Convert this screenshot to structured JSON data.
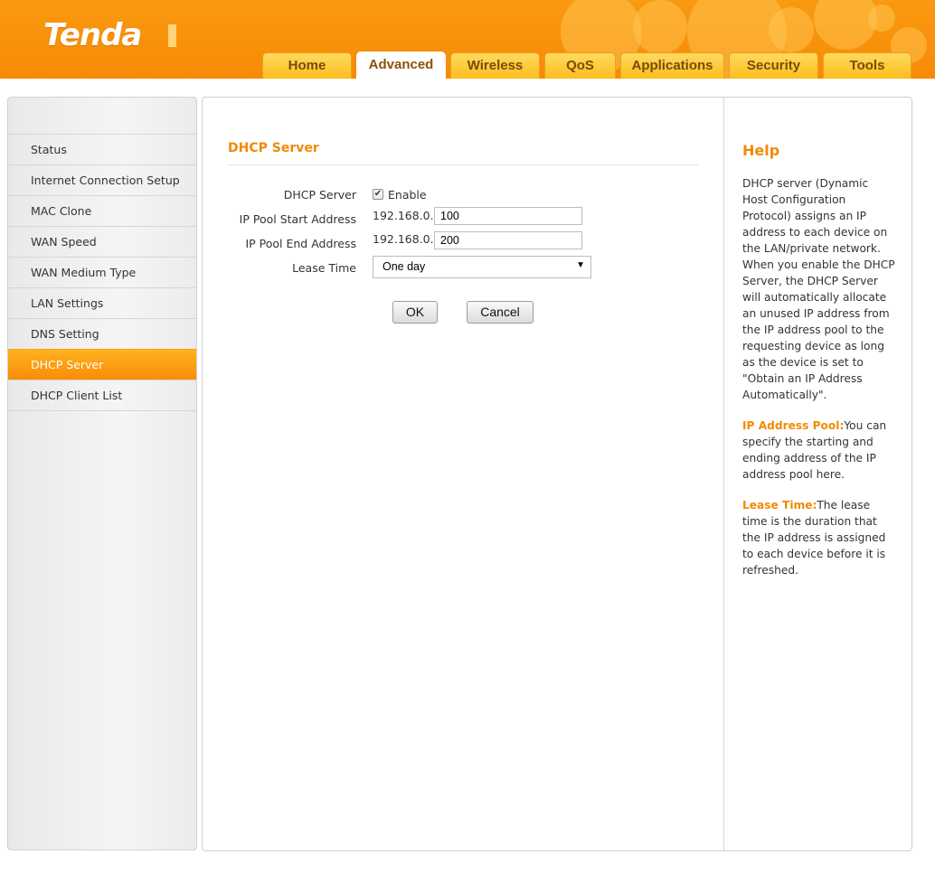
{
  "brand": {
    "logo": "Tenda"
  },
  "nav": {
    "tabs": [
      {
        "label": "Home"
      },
      {
        "label": "Advanced",
        "active": true
      },
      {
        "label": "Wireless"
      },
      {
        "label": "QoS"
      },
      {
        "label": "Applications"
      },
      {
        "label": "Security"
      },
      {
        "label": "Tools"
      }
    ]
  },
  "sidebar": {
    "items": [
      {
        "label": "Status"
      },
      {
        "label": "Internet Connection Setup"
      },
      {
        "label": "MAC Clone"
      },
      {
        "label": "WAN Speed"
      },
      {
        "label": "WAN Medium Type"
      },
      {
        "label": "LAN Settings"
      },
      {
        "label": "DNS Setting"
      },
      {
        "label": "DHCP Server",
        "active": true
      },
      {
        "label": "DHCP Client List"
      }
    ]
  },
  "form": {
    "title": "DHCP Server",
    "dhcp_server_label": "DHCP Server",
    "enable_label": "Enable",
    "enable_checked": true,
    "start_label": "IP Pool Start Address",
    "end_label": "IP Pool End Address",
    "ip_prefix": "192.168.0.",
    "start_value": "100",
    "end_value": "200",
    "lease_label": "Lease Time",
    "lease_value": "One day",
    "ok_label": "OK",
    "cancel_label": "Cancel"
  },
  "help": {
    "title": "Help",
    "intro": "DHCP server (Dynamic Host Configuration Protocol) assigns an IP address to each device on the LAN/private network. When you enable the DHCP Server, the DHCP Server will automatically allocate an unused IP address from the IP address pool to the requesting device as long as the device is set to \"Obtain an IP Address Automatically\".",
    "pool_key": "IP Address Pool:",
    "pool_text": "You can specify the starting and ending address of the IP address pool here.",
    "lease_key": "Lease Time:",
    "lease_text": "The lease time is the duration that the IP address is assigned to each device before it is refreshed."
  },
  "colors": {
    "brand_orange": "#f88a06",
    "tab_yellow": "#fcbe1c",
    "accent_text": "#f18a07"
  }
}
